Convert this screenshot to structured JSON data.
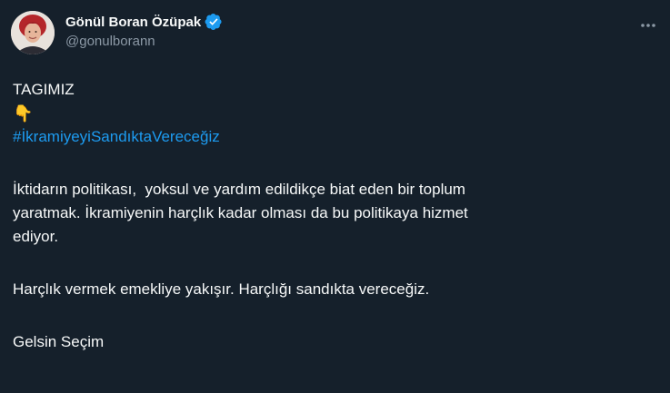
{
  "author": {
    "display_name": "Gönül Boran Özüpak",
    "handle": "@gonulborann",
    "verified": true,
    "verified_color": "#1d9bf0"
  },
  "menu": {
    "icon": "more-horizontal-icon"
  },
  "tweet": {
    "line1": "TAGIMIZ",
    "emoji": "👇",
    "hashtag": "#İkramiyeyiSandıktaVereceğiz",
    "para1_line1": "İktidarın politikası,  yoksul ve yardım edildikçe biat eden bir toplum",
    "para1_line2": "yaratmak. İkramiyenin harçlık kadar olması da bu politikaya hizmet",
    "para1_line3": "ediyor.",
    "para2": "Harçlık vermek emekliye yakışır. Harçlığı sandıkta vereceğiz.",
    "para3": "Gelsin Seçim"
  },
  "colors": {
    "background": "#15202b",
    "text": "#f7f9f9",
    "secondary": "#8b98a5",
    "link": "#1d9bf0"
  }
}
